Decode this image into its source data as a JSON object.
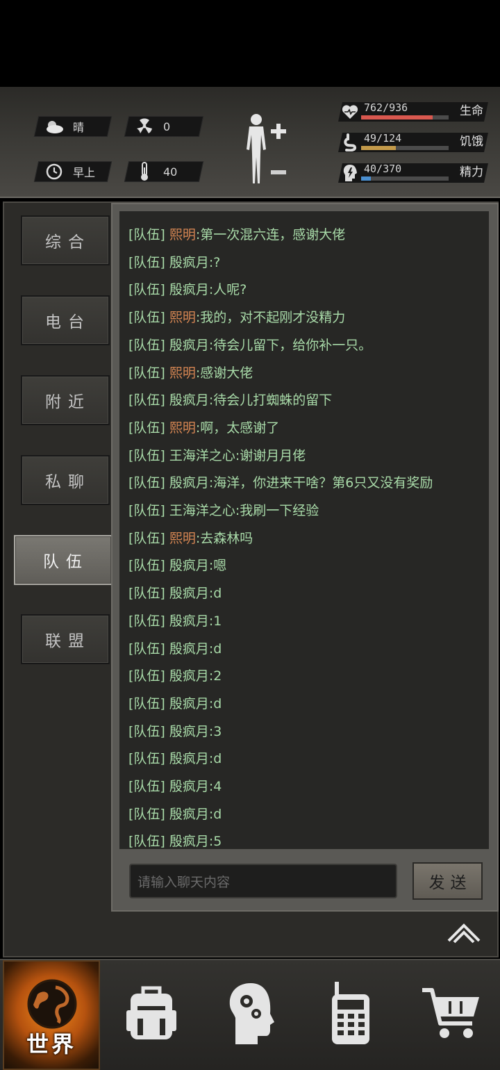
{
  "status": {
    "weather": "晴",
    "radiation": "0",
    "time_of_day": "早上",
    "temperature": "40"
  },
  "stats": {
    "health": {
      "value": "762/936",
      "label": "生命",
      "fraction": 0.814,
      "color": "#d9584f"
    },
    "hunger": {
      "value": "49/124",
      "label": "饥饿",
      "fraction": 0.395,
      "color": "#c39a4a"
    },
    "energy": {
      "value": "40/370",
      "label": "精力",
      "fraction": 0.108,
      "color": "#4a8fd1"
    }
  },
  "nav": {
    "tabs": [
      {
        "label": "综合"
      },
      {
        "label": "电台"
      },
      {
        "label": "附近"
      },
      {
        "label": "私聊"
      },
      {
        "label": "队伍"
      },
      {
        "label": "联盟"
      }
    ],
    "active_index": 4
  },
  "chat": {
    "messages": [
      {
        "channel": "[队伍]",
        "sender": "熙明",
        "text": ":第一次混六连，感谢大佬",
        "sender_color": "orange"
      },
      {
        "channel": "[队伍]",
        "sender": "殷疯月",
        "text": ":?",
        "sender_color": "green"
      },
      {
        "channel": "[队伍]",
        "sender": "殷疯月",
        "text": ":人呢?",
        "sender_color": "green"
      },
      {
        "channel": "[队伍]",
        "sender": "熙明",
        "text": ":我的，对不起刚才没精力",
        "sender_color": "orange"
      },
      {
        "channel": "[队伍]",
        "sender": "殷疯月",
        "text": ":待会儿留下，给你补一只。",
        "sender_color": "green"
      },
      {
        "channel": "[队伍]",
        "sender": "熙明",
        "text": ":感谢大佬",
        "sender_color": "orange"
      },
      {
        "channel": "[队伍]",
        "sender": "殷疯月",
        "text": ":待会儿打蜘蛛的留下",
        "sender_color": "green"
      },
      {
        "channel": "[队伍]",
        "sender": "熙明",
        "text": ":啊，太感谢了",
        "sender_color": "orange"
      },
      {
        "channel": "[队伍]",
        "sender": "王海洋之心",
        "text": ":谢谢月月佬",
        "sender_color": "green"
      },
      {
        "channel": "[队伍]",
        "sender": "殷疯月",
        "text": ":海洋，你进来干啥？第6只又没有奖励",
        "sender_color": "green"
      },
      {
        "channel": "[队伍]",
        "sender": "王海洋之心",
        "text": ":我刷一下经验",
        "sender_color": "green"
      },
      {
        "channel": "[队伍]",
        "sender": "熙明",
        "text": ":去森林吗",
        "sender_color": "orange"
      },
      {
        "channel": "[队伍]",
        "sender": "殷疯月",
        "text": ":嗯",
        "sender_color": "green"
      },
      {
        "channel": "[队伍]",
        "sender": "殷疯月",
        "text": ":d",
        "sender_color": "green"
      },
      {
        "channel": "[队伍]",
        "sender": "殷疯月",
        "text": ":1",
        "sender_color": "green"
      },
      {
        "channel": "[队伍]",
        "sender": "殷疯月",
        "text": ":d",
        "sender_color": "green"
      },
      {
        "channel": "[队伍]",
        "sender": "殷疯月",
        "text": ":2",
        "sender_color": "green"
      },
      {
        "channel": "[队伍]",
        "sender": "殷疯月",
        "text": ":d",
        "sender_color": "green"
      },
      {
        "channel": "[队伍]",
        "sender": "殷疯月",
        "text": ":3",
        "sender_color": "green"
      },
      {
        "channel": "[队伍]",
        "sender": "殷疯月",
        "text": ":d",
        "sender_color": "green"
      },
      {
        "channel": "[队伍]",
        "sender": "殷疯月",
        "text": ":4",
        "sender_color": "green"
      },
      {
        "channel": "[队伍]",
        "sender": "殷疯月",
        "text": ":d",
        "sender_color": "green"
      },
      {
        "channel": "[队伍]",
        "sender": "殷疯月",
        "text": ":5",
        "sender_color": "green"
      }
    ],
    "input_placeholder": "请输入聊天内容",
    "send_label": "发送"
  },
  "bottom_nav": {
    "items": [
      {
        "icon": "globe-icon",
        "label": "世界"
      },
      {
        "icon": "backpack-icon"
      },
      {
        "icon": "brain-gears-icon"
      },
      {
        "icon": "radio-icon"
      },
      {
        "icon": "cart-icon"
      }
    ]
  }
}
